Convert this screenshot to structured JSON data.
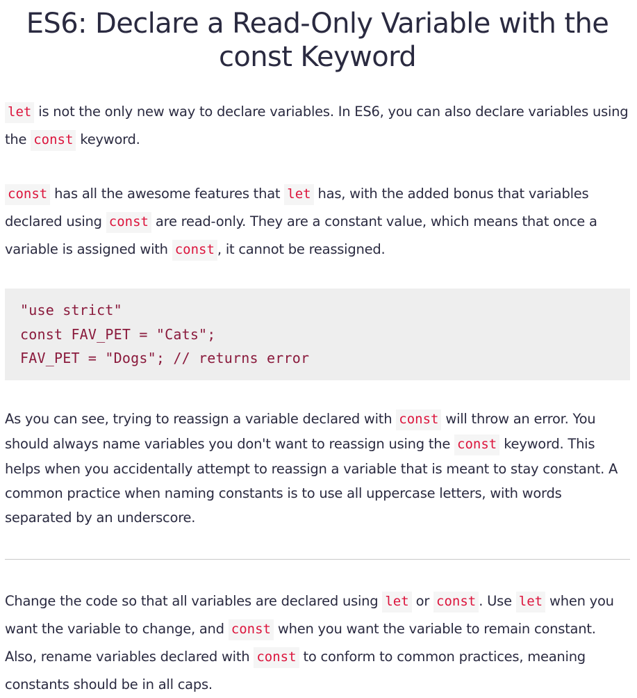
{
  "title_line1": "ES6: Declare a Read-Only Variable with the",
  "title_line2": "const Keyword",
  "paragraph1": {
    "s1_code": "let",
    "s1_text": " is not the only new way to declare variables. In ES6, you can also declare variables using the ",
    "s2_code": "const",
    "s2_text": " keyword."
  },
  "paragraph2": {
    "s1_code": "const",
    "s1_text": " has all the awesome features that ",
    "s2_code": "let",
    "s2_text": " has, with the added bonus that variables declared using ",
    "s3_code": "const",
    "s3_text": " are read-only. They are a constant value, which means that once a variable is assigned with ",
    "s4_code": "const",
    "s4_text": ", it cannot be reassigned."
  },
  "code_block": {
    "lines": [
      "\"use strict\"",
      "const FAV_PET = \"Cats\";",
      "FAV_PET = \"Dogs\"; // returns error"
    ]
  },
  "paragraph3": {
    "s1_text": "As you can see, trying to reassign a variable declared with ",
    "s1_code": "const",
    "s2_text": " will throw an error. You should always name variables you don't want to reassign using the ",
    "s2_code": "const",
    "s3_text": " keyword. This helps when you accidentally attempt to reassign a variable that is meant to stay constant. A common practice when naming constants is to use all uppercase letters, with words separated by an underscore."
  },
  "paragraph4": {
    "s1_text": "Change the code so that all variables are declared using ",
    "s1_code": "let",
    "s2_text": " or ",
    "s2_code": "const",
    "s3_text": ". Use ",
    "s3_code": "let",
    "s4_text": " when you want the variable to change, and ",
    "s4_code": "const",
    "s5_text": " when you want the variable to remain constant. Also, rename variables declared with ",
    "s5_code": "const",
    "s6_text": " to conform to common practices, meaning constants should be in all caps."
  }
}
